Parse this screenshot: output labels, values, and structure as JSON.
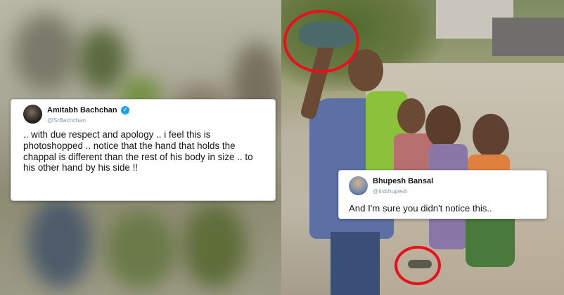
{
  "tweet_left": {
    "name": "Amitabh Bachchan",
    "handle": "@SrBachchan",
    "verified_icon": "verified-check-icon",
    "text": ".. with due respect and apology .. i feel this is photoshopped .. notice that the hand that holds the chappal is different than the rest of his body in size  .. to his other hand by his side !!"
  },
  "tweet_right": {
    "name": "Bhupesh Bansal",
    "handle": "@itsbhupesh",
    "text": "And I'm sure you didn't notice this.."
  },
  "colors": {
    "highlight_circle": "#e8101a",
    "verified": "#1da1f2",
    "handle": "#8899a6"
  }
}
